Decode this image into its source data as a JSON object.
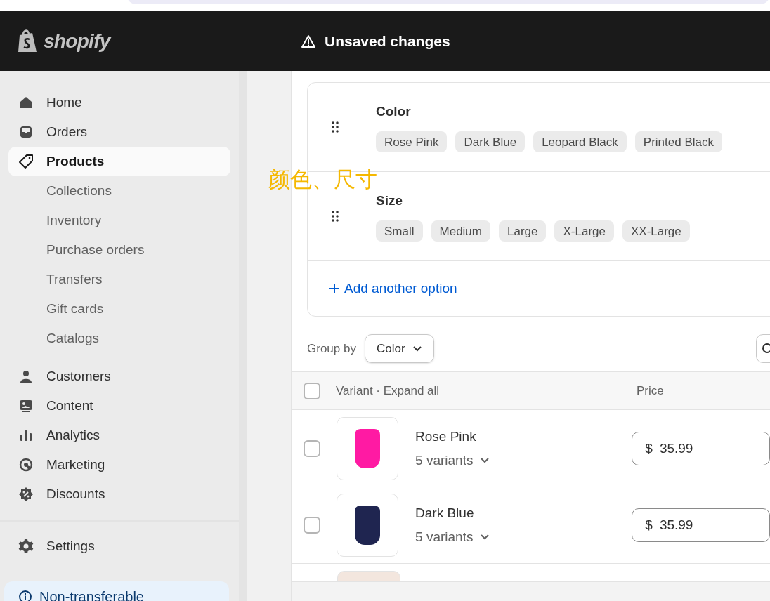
{
  "topbar": {
    "logo": "shopify",
    "status": "Unsaved changes"
  },
  "sidebar": {
    "items": [
      {
        "label": "Home",
        "kind": "main",
        "selected": false
      },
      {
        "label": "Orders",
        "kind": "main",
        "selected": false
      },
      {
        "label": "Products",
        "kind": "main",
        "selected": true
      },
      {
        "label": "Collections",
        "kind": "sub",
        "selected": false
      },
      {
        "label": "Inventory",
        "kind": "sub",
        "selected": false
      },
      {
        "label": "Purchase orders",
        "kind": "sub",
        "selected": false
      },
      {
        "label": "Transfers",
        "kind": "sub",
        "selected": false
      },
      {
        "label": "Gift cards",
        "kind": "sub",
        "selected": false
      },
      {
        "label": "Catalogs",
        "kind": "sub",
        "selected": false
      },
      {
        "label": "Customers",
        "kind": "main",
        "selected": false
      },
      {
        "label": "Content",
        "kind": "main",
        "selected": false
      },
      {
        "label": "Analytics",
        "kind": "main",
        "selected": false
      },
      {
        "label": "Marketing",
        "kind": "main",
        "selected": false
      },
      {
        "label": "Discounts",
        "kind": "main",
        "selected": false
      }
    ],
    "settings": "Settings",
    "notice": "Non-transferable"
  },
  "annotation": "颜色、尺寸",
  "options": {
    "items": [
      {
        "name": "Color",
        "values": [
          "Rose Pink",
          "Dark Blue",
          "Leopard Black",
          "Printed Black"
        ]
      },
      {
        "name": "Size",
        "values": [
          "Small",
          "Medium",
          "Large",
          "X-Large",
          "XX-Large"
        ]
      }
    ],
    "add_label": "Add another option"
  },
  "group_by": {
    "label": "Group by",
    "value": "Color"
  },
  "table": {
    "select_all_checked": false,
    "columns": [
      "Variant · Expand all",
      "Price"
    ],
    "rows": [
      {
        "name": "Rose Pink",
        "variants": "5 variants",
        "currency": "$",
        "price": "35.99",
        "checked": false,
        "color": "#ff1aa3"
      },
      {
        "name": "Dark Blue",
        "variants": "5 variants",
        "currency": "$",
        "price": "35.99",
        "checked": false,
        "color": "#1f2550"
      }
    ]
  }
}
